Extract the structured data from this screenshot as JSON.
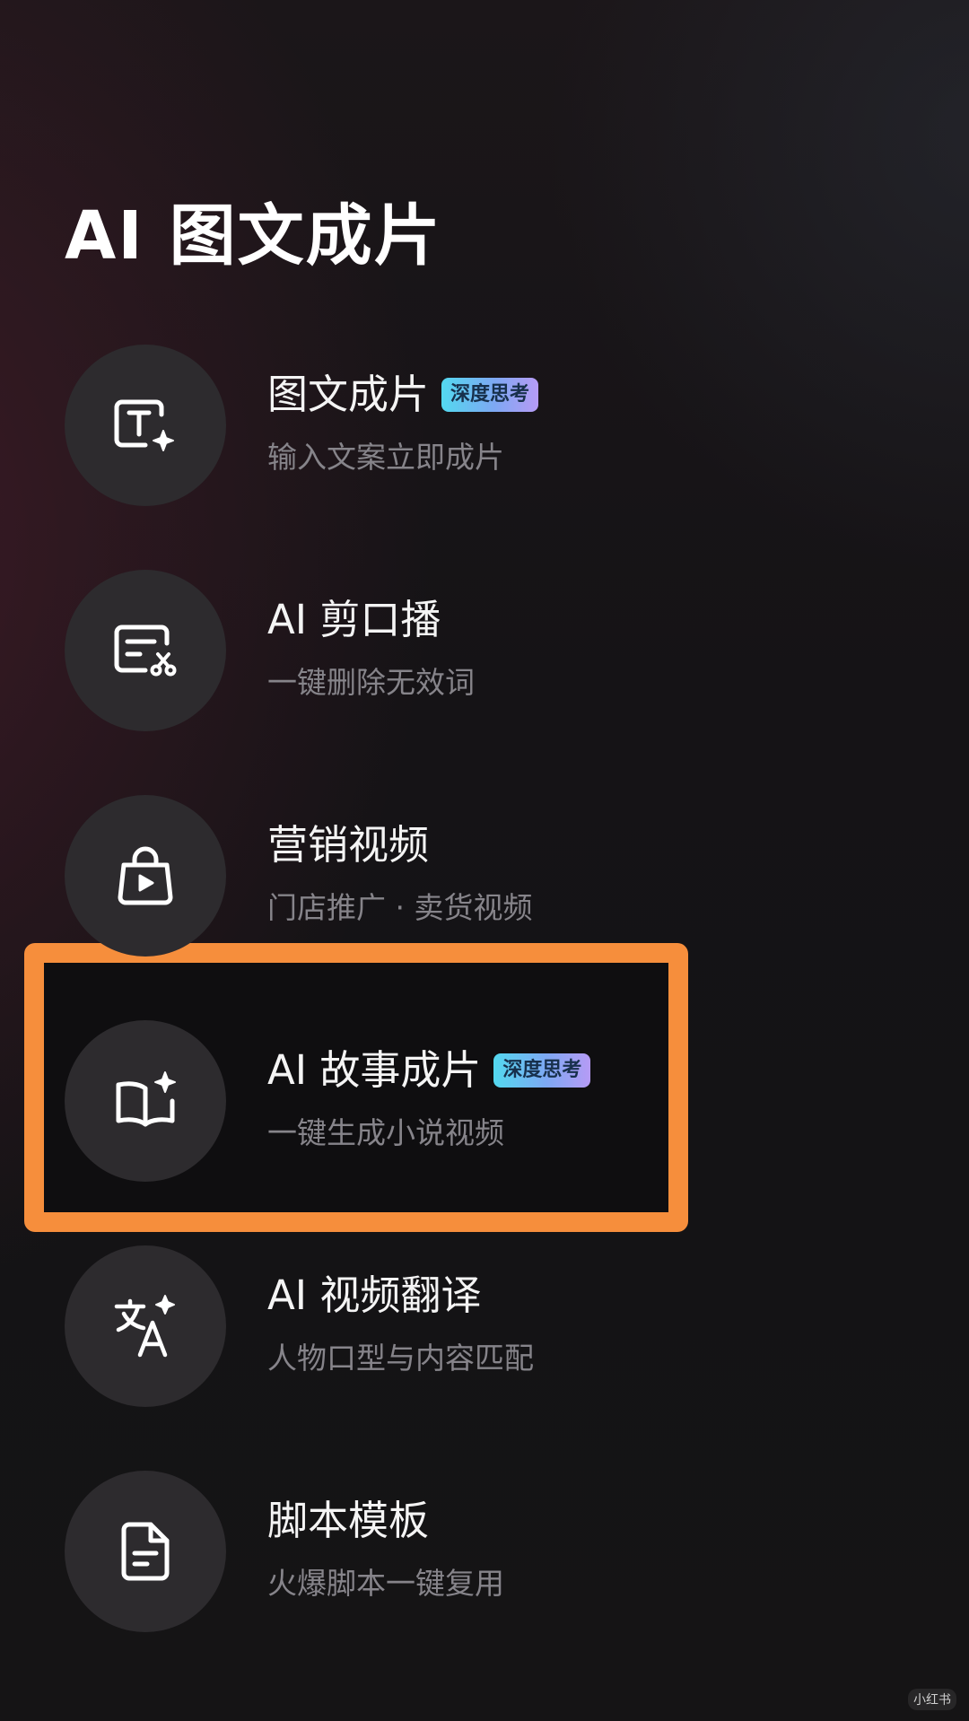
{
  "page": {
    "title": "AI 图文成片",
    "watermark": "小红书"
  },
  "items": [
    {
      "icon": "text-sparkle-icon",
      "title": "图文成片",
      "badge": "深度思考",
      "subtitle": "输入文案立即成片"
    },
    {
      "icon": "script-cut-icon",
      "title": "AI 剪口播",
      "badge": "",
      "subtitle": "一键删除无效词"
    },
    {
      "icon": "shopping-bag-play-icon",
      "title": "营销视频",
      "badge": "",
      "subtitle": "门店推广 · 卖货视频"
    },
    {
      "icon": "book-sparkle-icon",
      "title": "AI 故事成片",
      "badge": "深度思考",
      "subtitle": "一键生成小说视频"
    },
    {
      "icon": "translate-icon",
      "title": "AI 视频翻译",
      "badge": "",
      "subtitle": "人物口型与内容匹配"
    },
    {
      "icon": "document-icon",
      "title": "脚本模板",
      "badge": "",
      "subtitle": "火爆脚本一键复用"
    }
  ],
  "colors": {
    "highlight": "#f68e3c",
    "badge_gradient": [
      "#53d8ef",
      "#b69bf5"
    ],
    "icon_circle": "#2d2b2e",
    "subtitle": "#86848a"
  }
}
